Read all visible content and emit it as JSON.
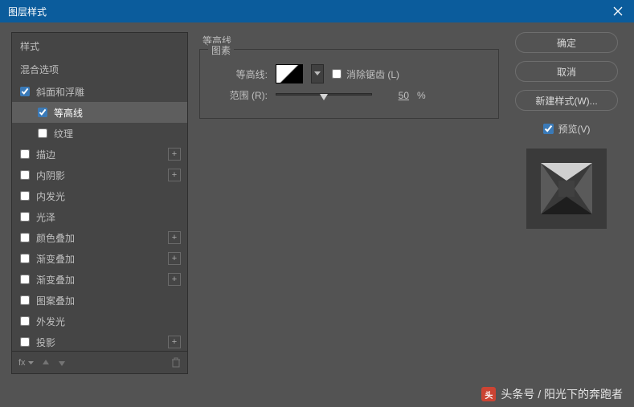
{
  "dialog": {
    "title": "图层样式",
    "close_label": "✕"
  },
  "sidebar": {
    "styles_header": "样式",
    "blend_options": "混合选项",
    "items": [
      {
        "label": "斜面和浮雕",
        "checked": true,
        "expandable": false,
        "sub": false
      },
      {
        "label": "等高线",
        "checked": true,
        "expandable": false,
        "sub": true,
        "selected": true
      },
      {
        "label": "纹理",
        "checked": false,
        "expandable": false,
        "sub": true
      },
      {
        "label": "描边",
        "checked": false,
        "expandable": true
      },
      {
        "label": "内阴影",
        "checked": false,
        "expandable": true
      },
      {
        "label": "内发光",
        "checked": false,
        "expandable": false
      },
      {
        "label": "光泽",
        "checked": false,
        "expandable": false
      },
      {
        "label": "颜色叠加",
        "checked": false,
        "expandable": true
      },
      {
        "label": "渐变叠加",
        "checked": false,
        "expandable": true
      },
      {
        "label": "渐变叠加",
        "checked": false,
        "expandable": true
      },
      {
        "label": "图案叠加",
        "checked": false,
        "expandable": false
      },
      {
        "label": "外发光",
        "checked": false,
        "expandable": false
      },
      {
        "label": "投影",
        "checked": false,
        "expandable": true
      }
    ],
    "footer": {
      "fx": "fx"
    }
  },
  "main": {
    "title": "等高线",
    "fieldset_legend": "图素",
    "contour_label": "等高线:",
    "antialias_label": "消除锯齿 (L)",
    "range_label": "范围 (R):",
    "range_value": "50",
    "range_unit": "%"
  },
  "right": {
    "ok": "确定",
    "cancel": "取消",
    "new_style": "新建样式(W)...",
    "preview_label": "预览(V)"
  },
  "watermark": {
    "text": "头条号 / 阳光下的奔跑者"
  }
}
